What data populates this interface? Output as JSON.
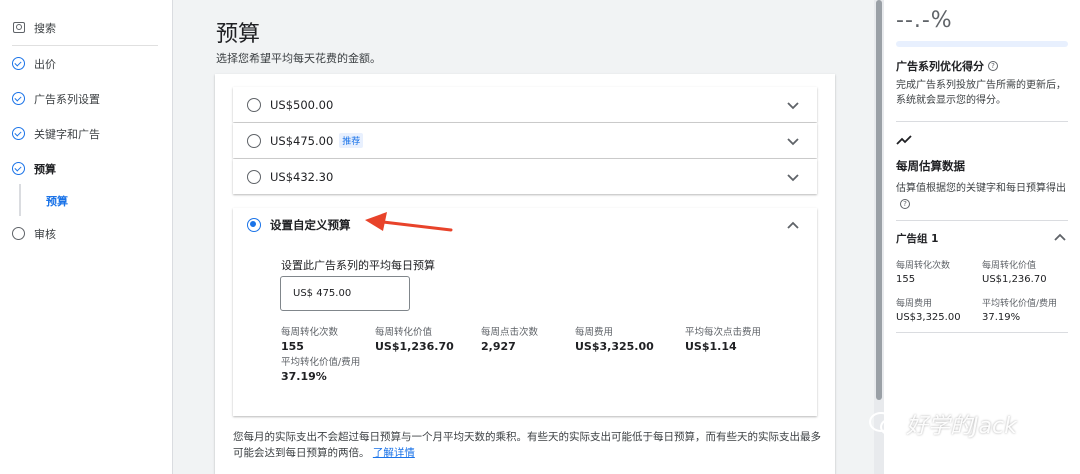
{
  "sidebar": {
    "items": [
      {
        "label": "搜索"
      },
      {
        "label": "出价"
      },
      {
        "label": "广告系列设置"
      },
      {
        "label": "关键字和广告"
      },
      {
        "label": "预算"
      },
      {
        "label": "审核"
      }
    ],
    "sub_item": "预算"
  },
  "main": {
    "title": "预算",
    "subtitle": "选择您希望平均每天花费的金额。",
    "options": [
      {
        "label": "US$500.00"
      },
      {
        "label": "US$475.00",
        "badge": "推荐"
      },
      {
        "label": "US$432.30"
      }
    ],
    "custom": {
      "label": "设置自定义预算",
      "input_label": "设置此广告系列的平均每日预算",
      "input_value": "US$ 475.00",
      "stats": [
        {
          "label": "每周转化次数",
          "value": "155"
        },
        {
          "label": "每周转化价值",
          "value": "US$1,236.70"
        },
        {
          "label": "每周点击次数",
          "value": "2,927"
        },
        {
          "label": "每周费用",
          "value": "US$3,325.00"
        },
        {
          "label": "平均每次点击费用",
          "value": "US$1.14"
        },
        {
          "label": "平均转化价值/费用",
          "value": "37.19%"
        }
      ]
    },
    "footnote": "您每月的实际支出不会超过每日预算与一个月平均天数的乘积。有些天的实际支出可能低于每日预算，而有些天的实际支出最多可能会达到每日预算的两倍。",
    "learn_more": "了解详情"
  },
  "right_panel": {
    "score": "--.-%",
    "score_title": "广告系列优化得分",
    "score_desc": "完成广告系列投放广告所需的更新后，系统就会显示您的得分。",
    "weekly_title": "每周估算数据",
    "weekly_desc": "估算值根据您的关键字和每日预算得出",
    "group_title": "广告组 1",
    "stats": [
      {
        "label": "每周转化次数",
        "value": "155"
      },
      {
        "label": "每周转化价值",
        "value": "US$1,236.70"
      },
      {
        "label": "每周费用",
        "value": "US$3,325.00"
      },
      {
        "label": "平均转化价值/费用",
        "value": "37.19%"
      }
    ]
  },
  "watermark": "好学的Jack",
  "colors": {
    "accent": "#1a73e8",
    "arrow": "#e8432a"
  }
}
